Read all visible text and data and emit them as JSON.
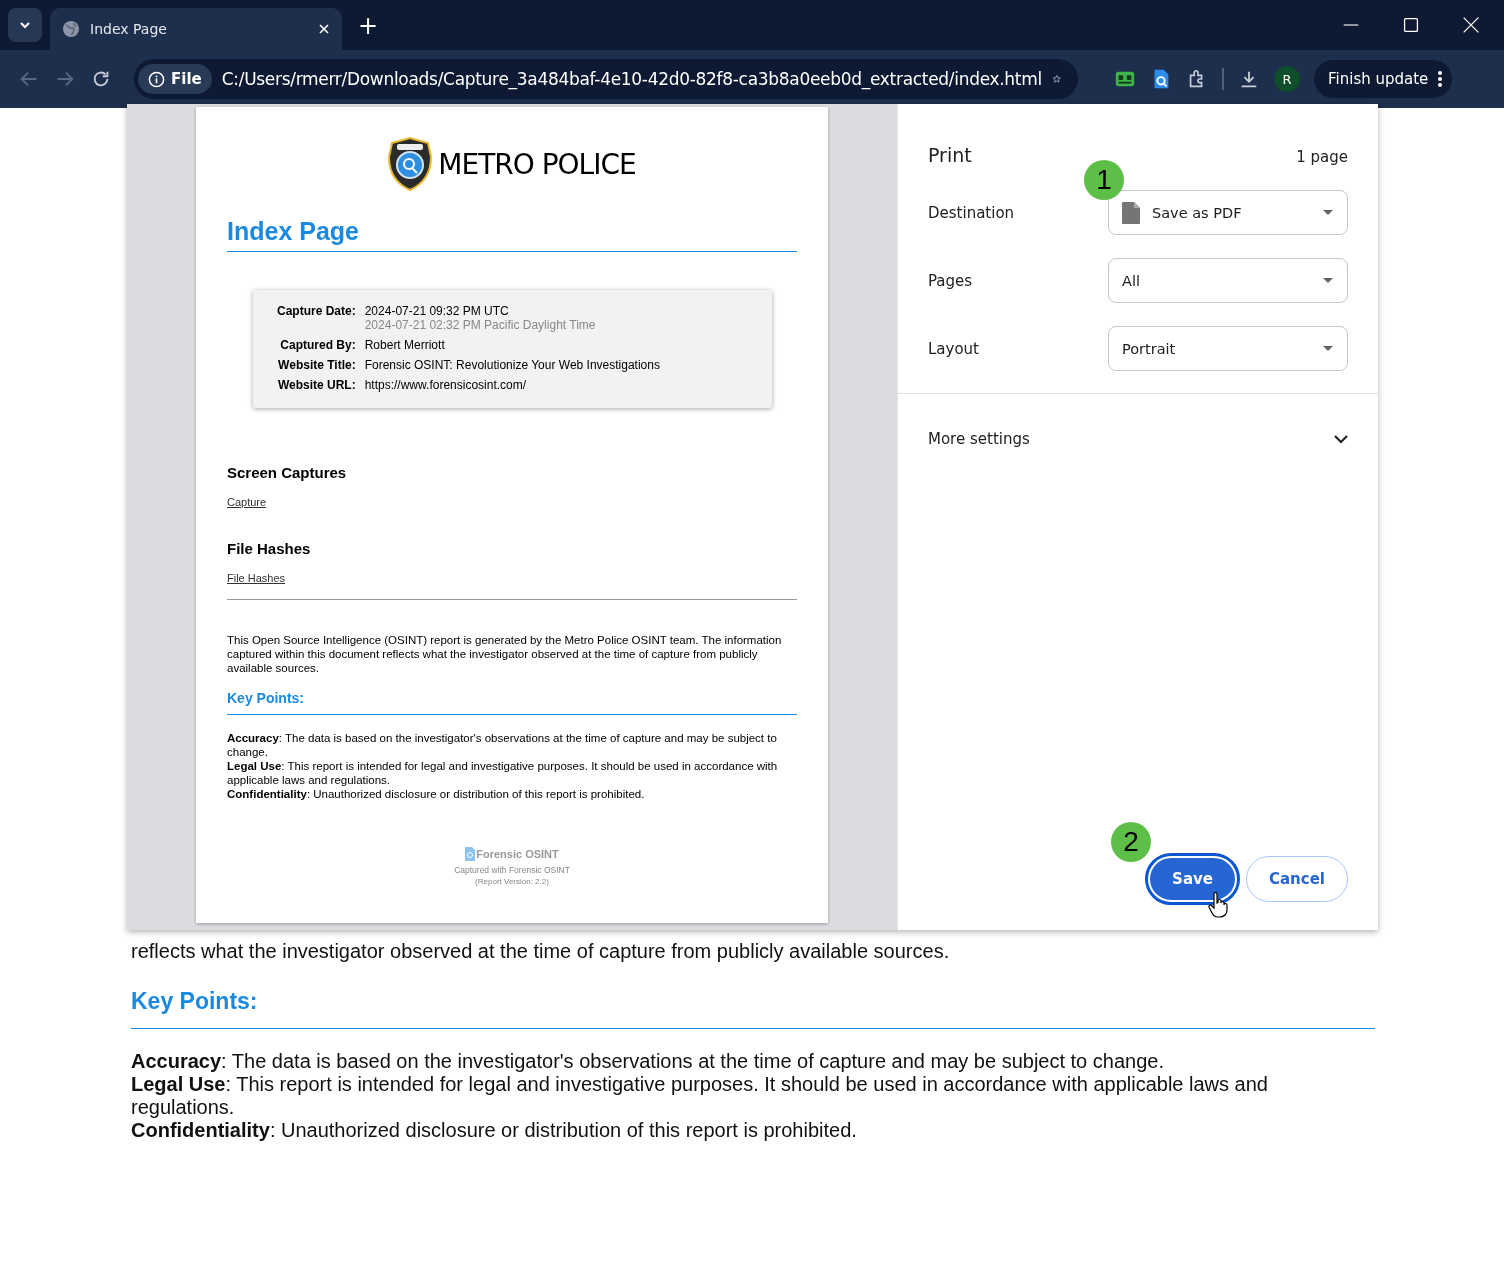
{
  "browser": {
    "tab": {
      "title": "Index Page",
      "selected": true
    },
    "new_tab": "+",
    "toolbar": {
      "scheme": "File",
      "url": "C:/Users/rmerr/Downloads/Capture_3a484baf-4e10-42d0-82f8-ca3b8a0eeb0d_extracted/index.html",
      "profile": "R",
      "finish_update": "Finish update"
    }
  },
  "print_preview": {
    "logo_text": "METRO POLICE",
    "title": "Index Page",
    "capture_info": [
      {
        "label": "Capture Date:",
        "value": "2024-07-21 09:32 PM UTC",
        "secondary": "2024-07-21 02:32 PM Pacific Daylight Time"
      },
      {
        "label": "Captured By:",
        "value": "Robert Merriott"
      },
      {
        "label": "Website Title:",
        "value": "Forensic OSINT: Revolutionize Your Web Investigations"
      },
      {
        "label": "Website URL:",
        "value": "https://www.forensicosint.com/"
      }
    ],
    "sections": [
      {
        "heading": "Screen Captures",
        "link": "Capture"
      },
      {
        "heading": "File Hashes",
        "link": "File Hashes"
      }
    ],
    "intro": "This Open Source Intelligence (OSINT) report is generated by the Metro Police OSINT team. The information captured within this document reflects what the investigator observed at the time of capture from publicly available sources.",
    "key_points_heading": "Key Points:",
    "key_points": [
      "**Accuracy**: The data is based on the investigator's observations at the time of capture and may be subject to change.",
      "**Legal Use**: This report is intended for legal and investigative purposes. It should be used in accordance with applicable laws and regulations.",
      "**Confidentiality**: Unauthorized disclosure or distribution of this report is prohibited."
    ],
    "footer": {
      "brand": "Forensic OSINT",
      "captured_with": "Captured with Forensic OSINT",
      "version": "(Report Version: 2.2)"
    }
  },
  "print_panel": {
    "title": "Print",
    "page_count": "1 page",
    "settings": [
      {
        "label": "Destination",
        "value": "Save as PDF",
        "kind": "destination"
      },
      {
        "label": "Pages",
        "value": "All",
        "kind": "select"
      },
      {
        "label": "Layout",
        "value": "Portrait",
        "kind": "select"
      }
    ],
    "more_settings": {
      "label": "More settings",
      "expanded": false
    },
    "buttons": [
      {
        "label": "Save",
        "kind": "primary",
        "focused": true
      },
      {
        "label": "Cancel",
        "kind": "secondary",
        "focused": false
      }
    ]
  },
  "annotations": [
    {
      "number": "1"
    },
    {
      "number": "2"
    }
  ],
  "background_page": {
    "intro": "reflects what the investigator observed at the time of capture from publicly available sources.",
    "key_points_heading": "Key Points:",
    "key_points": [
      "**Accuracy**: The data is based on the investigator's observations at the time of capture and may be subject to change.",
      "**Legal Use**: This report is intended for legal and investigative purposes. It should be used in accordance with applicable laws and regulations.",
      "**Confidentiality**: Unauthorized disclosure or distribution of this report is prohibited."
    ]
  }
}
